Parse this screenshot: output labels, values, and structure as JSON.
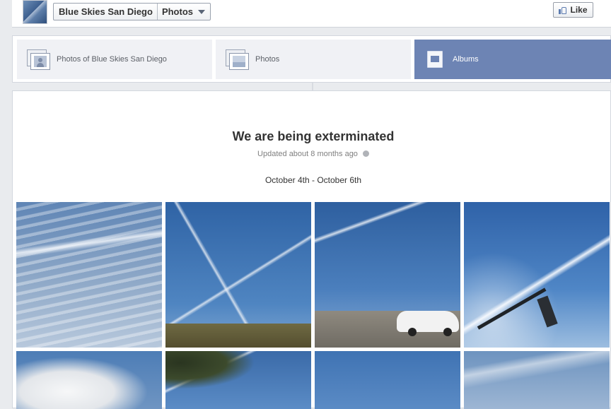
{
  "header": {
    "page_name": "Blue Skies San Diego",
    "section": "Photos",
    "like_label": "Like"
  },
  "tabs": [
    {
      "label": "Photos of Blue Skies San Diego",
      "icon": "photos-of-icon",
      "active": false
    },
    {
      "label": "Photos",
      "icon": "photos-icon",
      "active": false
    },
    {
      "label": "Albums",
      "icon": "albums-icon",
      "active": true
    }
  ],
  "album": {
    "title": "We are being exterminated",
    "updated": "Updated about 8 months ago",
    "privacy_icon": "globe-icon",
    "description": "October 4th - October 6th",
    "photo_count_visible": 8
  },
  "colors": {
    "active_tab": "#6d84b4",
    "page_bg": "#e9ebee"
  }
}
